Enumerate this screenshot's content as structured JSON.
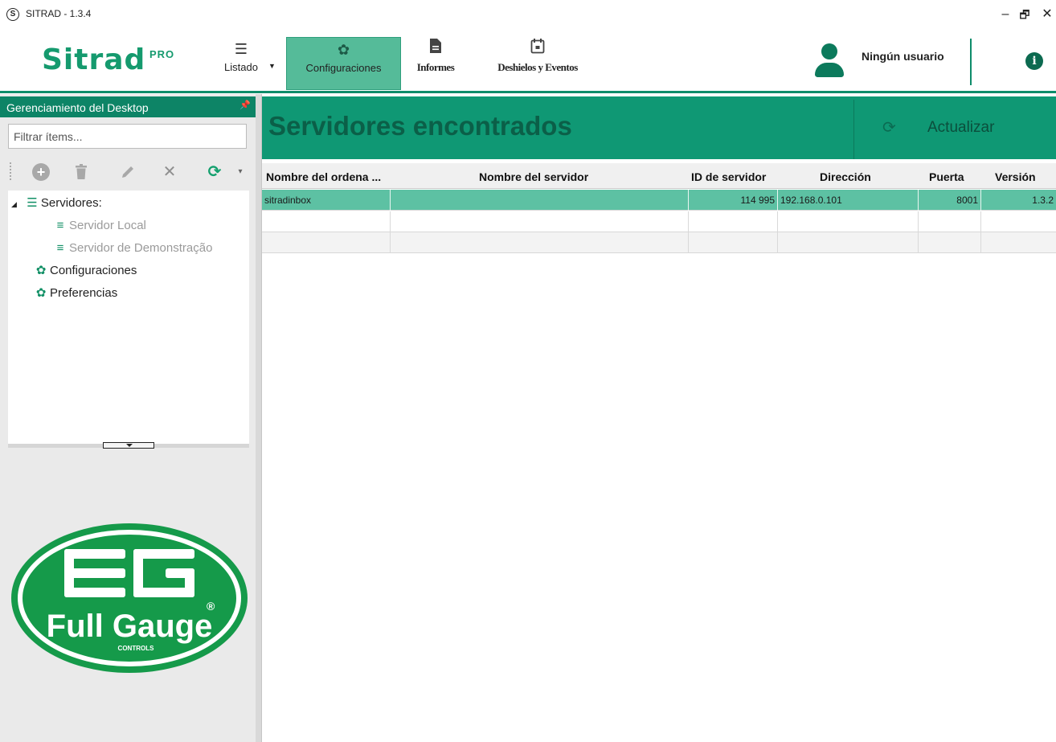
{
  "window": {
    "icon": "S",
    "title": "SITRAD - 1.3.4",
    "controls": {
      "minimize": "–",
      "restore": "🗗",
      "close": "✕"
    }
  },
  "ribbon": {
    "logo_text": "Sitrad",
    "logo_suffix": "PRO",
    "listado_label": "Listado",
    "config_label": "Configuraciones",
    "informes_label": "Informes",
    "deshielos_label": "Deshielos y Eventos",
    "user_name": "Ningún usuario",
    "info_icon": "i"
  },
  "left_panel": {
    "title": "Gerenciamiento del Desktop",
    "filter_placeholder": "Filtrar ítems...",
    "toolbar_icons": [
      "add-icon",
      "trash-icon",
      "pencil-icon",
      "tools-icon",
      "refresh-icon"
    ],
    "tree": {
      "servidores_label": "Servidores:",
      "servidor_local": "Servidor Local",
      "servidor_demo": "Servidor de Demonstração",
      "configuraciones": "Configuraciones",
      "preferencias": "Preferencias"
    }
  },
  "brand_logo": {
    "mark": "FG",
    "name": "Full Gauge",
    "sub": "CONTROLS",
    "reg": "®"
  },
  "main": {
    "title": "Servidores encontrados",
    "refresh_label": "Actualizar",
    "columns": {
      "computer": "Nombre del ordena ...",
      "server_name": "Nombre del servidor",
      "server_id": "ID de servidor",
      "address": "Dirección",
      "port": "Puerta",
      "version": "Versión"
    },
    "rows": [
      {
        "computer": "sitradinbox",
        "server_name": "",
        "server_id": "114 995",
        "address": "192.168.0.101",
        "port": "8001",
        "version": "1.3.2"
      },
      {
        "computer": "",
        "server_name": "",
        "server_id": "",
        "address": "",
        "port": "",
        "version": ""
      },
      {
        "computer": "",
        "server_name": "",
        "server_id": "",
        "address": "",
        "port": "",
        "version": ""
      }
    ]
  },
  "colors": {
    "accent": "#0f9874",
    "accent_dark": "#0b5f48",
    "selection": "#5dc1a3",
    "logo_green": "#159a6e"
  }
}
